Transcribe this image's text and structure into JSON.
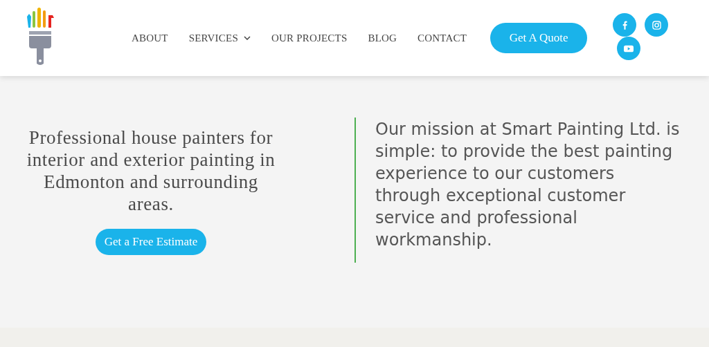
{
  "nav": [
    {
      "label": "ABOUT",
      "dropdown": false
    },
    {
      "label": "SERVICES",
      "dropdown": true
    },
    {
      "label": "OUR PROJECTS",
      "dropdown": false
    },
    {
      "label": "BLOG",
      "dropdown": false
    },
    {
      "label": "CONTACT",
      "dropdown": false
    }
  ],
  "quote_button": "Get A Quote",
  "socials": [
    {
      "kind": "facebook"
    },
    {
      "kind": "instagram"
    },
    {
      "kind": "youtube"
    }
  ],
  "hero": {
    "headline": "Professional house painters for interior and exterior painting in Edmonton and surrounding areas.",
    "button": "Get a Free Estimate",
    "mission": "Our mission at Smart Painting Ltd. is simple: to provide the best painting experience to our customers through exceptional customer service and professional workmanship."
  }
}
